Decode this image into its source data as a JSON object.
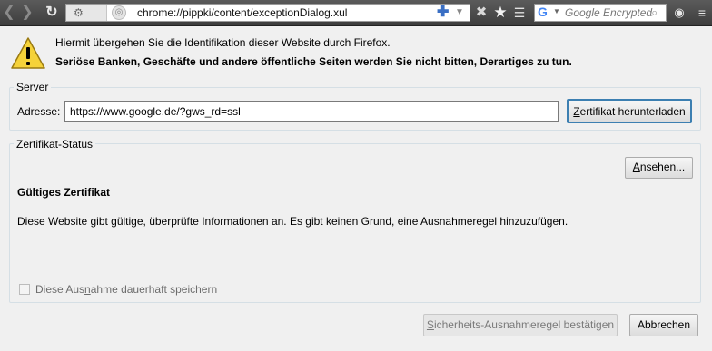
{
  "browser": {
    "url": "chrome://pippki/content/exceptionDialog.xul",
    "search_placeholder": "Google Encrypted"
  },
  "dialog": {
    "intro": "Hiermit übergehen Sie die Identifikation dieser Website durch Firefox.",
    "warning": "Seriöse Banken, Geschäfte und andere öffentliche Seiten werden Sie nicht bitten, Derartiges zu tun.",
    "server": {
      "caption": "Server",
      "address_label": "Adresse:",
      "address_value": "https://www.google.de/?gws_rd=ssl",
      "download_button": "Zertifikat herunterladen"
    },
    "status": {
      "caption": "Zertifikat-Status",
      "view_button": "Ansehen...",
      "title": "Gültiges Zertifikat",
      "description": "Diese Website gibt gültige, überprüfte Informationen an.  Es gibt keinen Grund, eine Ausnahmeregel hinzuzufügen."
    },
    "permanent_label": "Diese Ausnahme dauerhaft speichern",
    "confirm_button": "Sicherheits-Ausnahmeregel bestätigen",
    "cancel_button": "Abbrechen"
  }
}
